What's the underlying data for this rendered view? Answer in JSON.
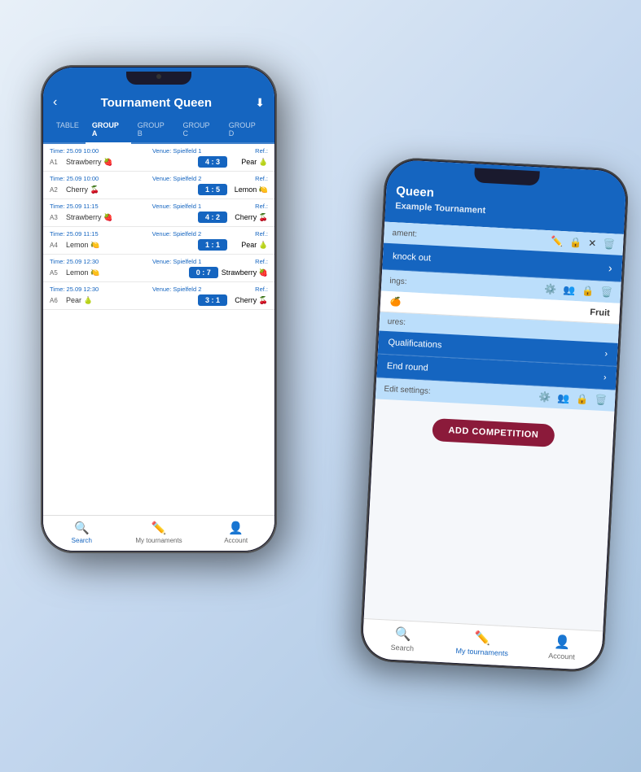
{
  "app": {
    "name": "Tournament Queen"
  },
  "front_phone": {
    "header": {
      "title": "Tournament Queen",
      "back_arrow": "‹",
      "download_icon": "⬇"
    },
    "tabs": [
      {
        "id": "table",
        "label": "TABLE",
        "active": false
      },
      {
        "id": "group_a",
        "label": "GROUP A",
        "active": true
      },
      {
        "id": "group_b",
        "label": "GROUP B",
        "active": false
      },
      {
        "id": "group_c",
        "label": "GROUP C",
        "active": false
      },
      {
        "id": "group_d",
        "label": "GROUP D",
        "active": false
      }
    ],
    "matches": [
      {
        "id": "A1",
        "time": "Time: 25.09 10:00",
        "venue": "Venue: Spielfeld 1",
        "ref_label": "Ref.:",
        "ref_name": "Pear 🍐",
        "team1": "Strawberry 🍓",
        "score": "4 : 3",
        "team2": ""
      },
      {
        "id": "A2",
        "time": "Time: 25.09 10:00",
        "venue": "Venue: Spielfeld 2",
        "ref_label": "Ref.:",
        "ref_name": "Lemon 🍋",
        "team1": "Cherry 🍒",
        "score": "1 : 5",
        "team2": ""
      },
      {
        "id": "A3",
        "time": "Time: 25.09 11:15",
        "venue": "Venue: Spielfeld 1",
        "ref_label": "Ref.:",
        "ref_name": "Cherry 🍒",
        "team1": "Strawberry 🍓",
        "score": "4 : 2",
        "team2": ""
      },
      {
        "id": "A4",
        "time": "Time: 25.09 11:15",
        "venue": "Venue: Spielfeld 2",
        "ref_label": "Ref.:",
        "ref_name": "Pear 🍐",
        "team1": "Lemon 🍋",
        "score": "1 : 1",
        "team2": ""
      },
      {
        "id": "A5",
        "time": "Time: 25.09 12:30",
        "venue": "Venue: Spielfeld 1",
        "ref_label": "Ref.:",
        "ref_name": "Strawberry 🍓",
        "team1": "Lemon 🍋",
        "score": "0 : 7",
        "team2": ""
      },
      {
        "id": "A6",
        "time": "Time: 25.09 12:30",
        "venue": "Venue: Spielfeld 2",
        "ref_label": "Ref.:",
        "ref_name": "Cherry 🍒",
        "team1": "Pear 🍐",
        "score": "3 : 1",
        "team2": ""
      }
    ],
    "bottom_nav": [
      {
        "id": "search",
        "label": "Search",
        "icon": "🔍",
        "active": true
      },
      {
        "id": "my_tournaments",
        "label": "My tournaments",
        "icon": "✏️",
        "active": false
      },
      {
        "id": "account",
        "label": "Account",
        "icon": "👤",
        "active": false
      }
    ]
  },
  "back_phone": {
    "header": {
      "title": "Queen",
      "subtitle": "Example Tournament"
    },
    "tournament_label": "ament:",
    "edit_icons": [
      "✏️",
      "🔒",
      "✕",
      "🗑️"
    ],
    "knockout_row": {
      "label": "knock out",
      "has_chevron": true
    },
    "edit_settings_1": {
      "label": "ings:",
      "icons": [
        "⚙️",
        "👥",
        "🔒",
        "🗑️"
      ]
    },
    "competition_name_1": "Fruit",
    "venues_label": "ures:",
    "qualifications_row": {
      "label": "Qualifications",
      "has_chevron": true
    },
    "end_round_row": {
      "label": "End round",
      "has_chevron": true
    },
    "edit_settings_2": {
      "label": "Edit settings:",
      "icons": [
        "⚙️",
        "👥",
        "🔒",
        "🗑️"
      ]
    },
    "add_competition_btn": "ADD COMPETITION",
    "bottom_nav": [
      {
        "id": "search",
        "label": "Search",
        "icon": "🔍",
        "active": false
      },
      {
        "id": "my_tournaments",
        "label": "My tournaments",
        "icon": "✏️",
        "active": true
      },
      {
        "id": "account",
        "label": "Account",
        "icon": "👤",
        "active": false
      }
    ]
  }
}
